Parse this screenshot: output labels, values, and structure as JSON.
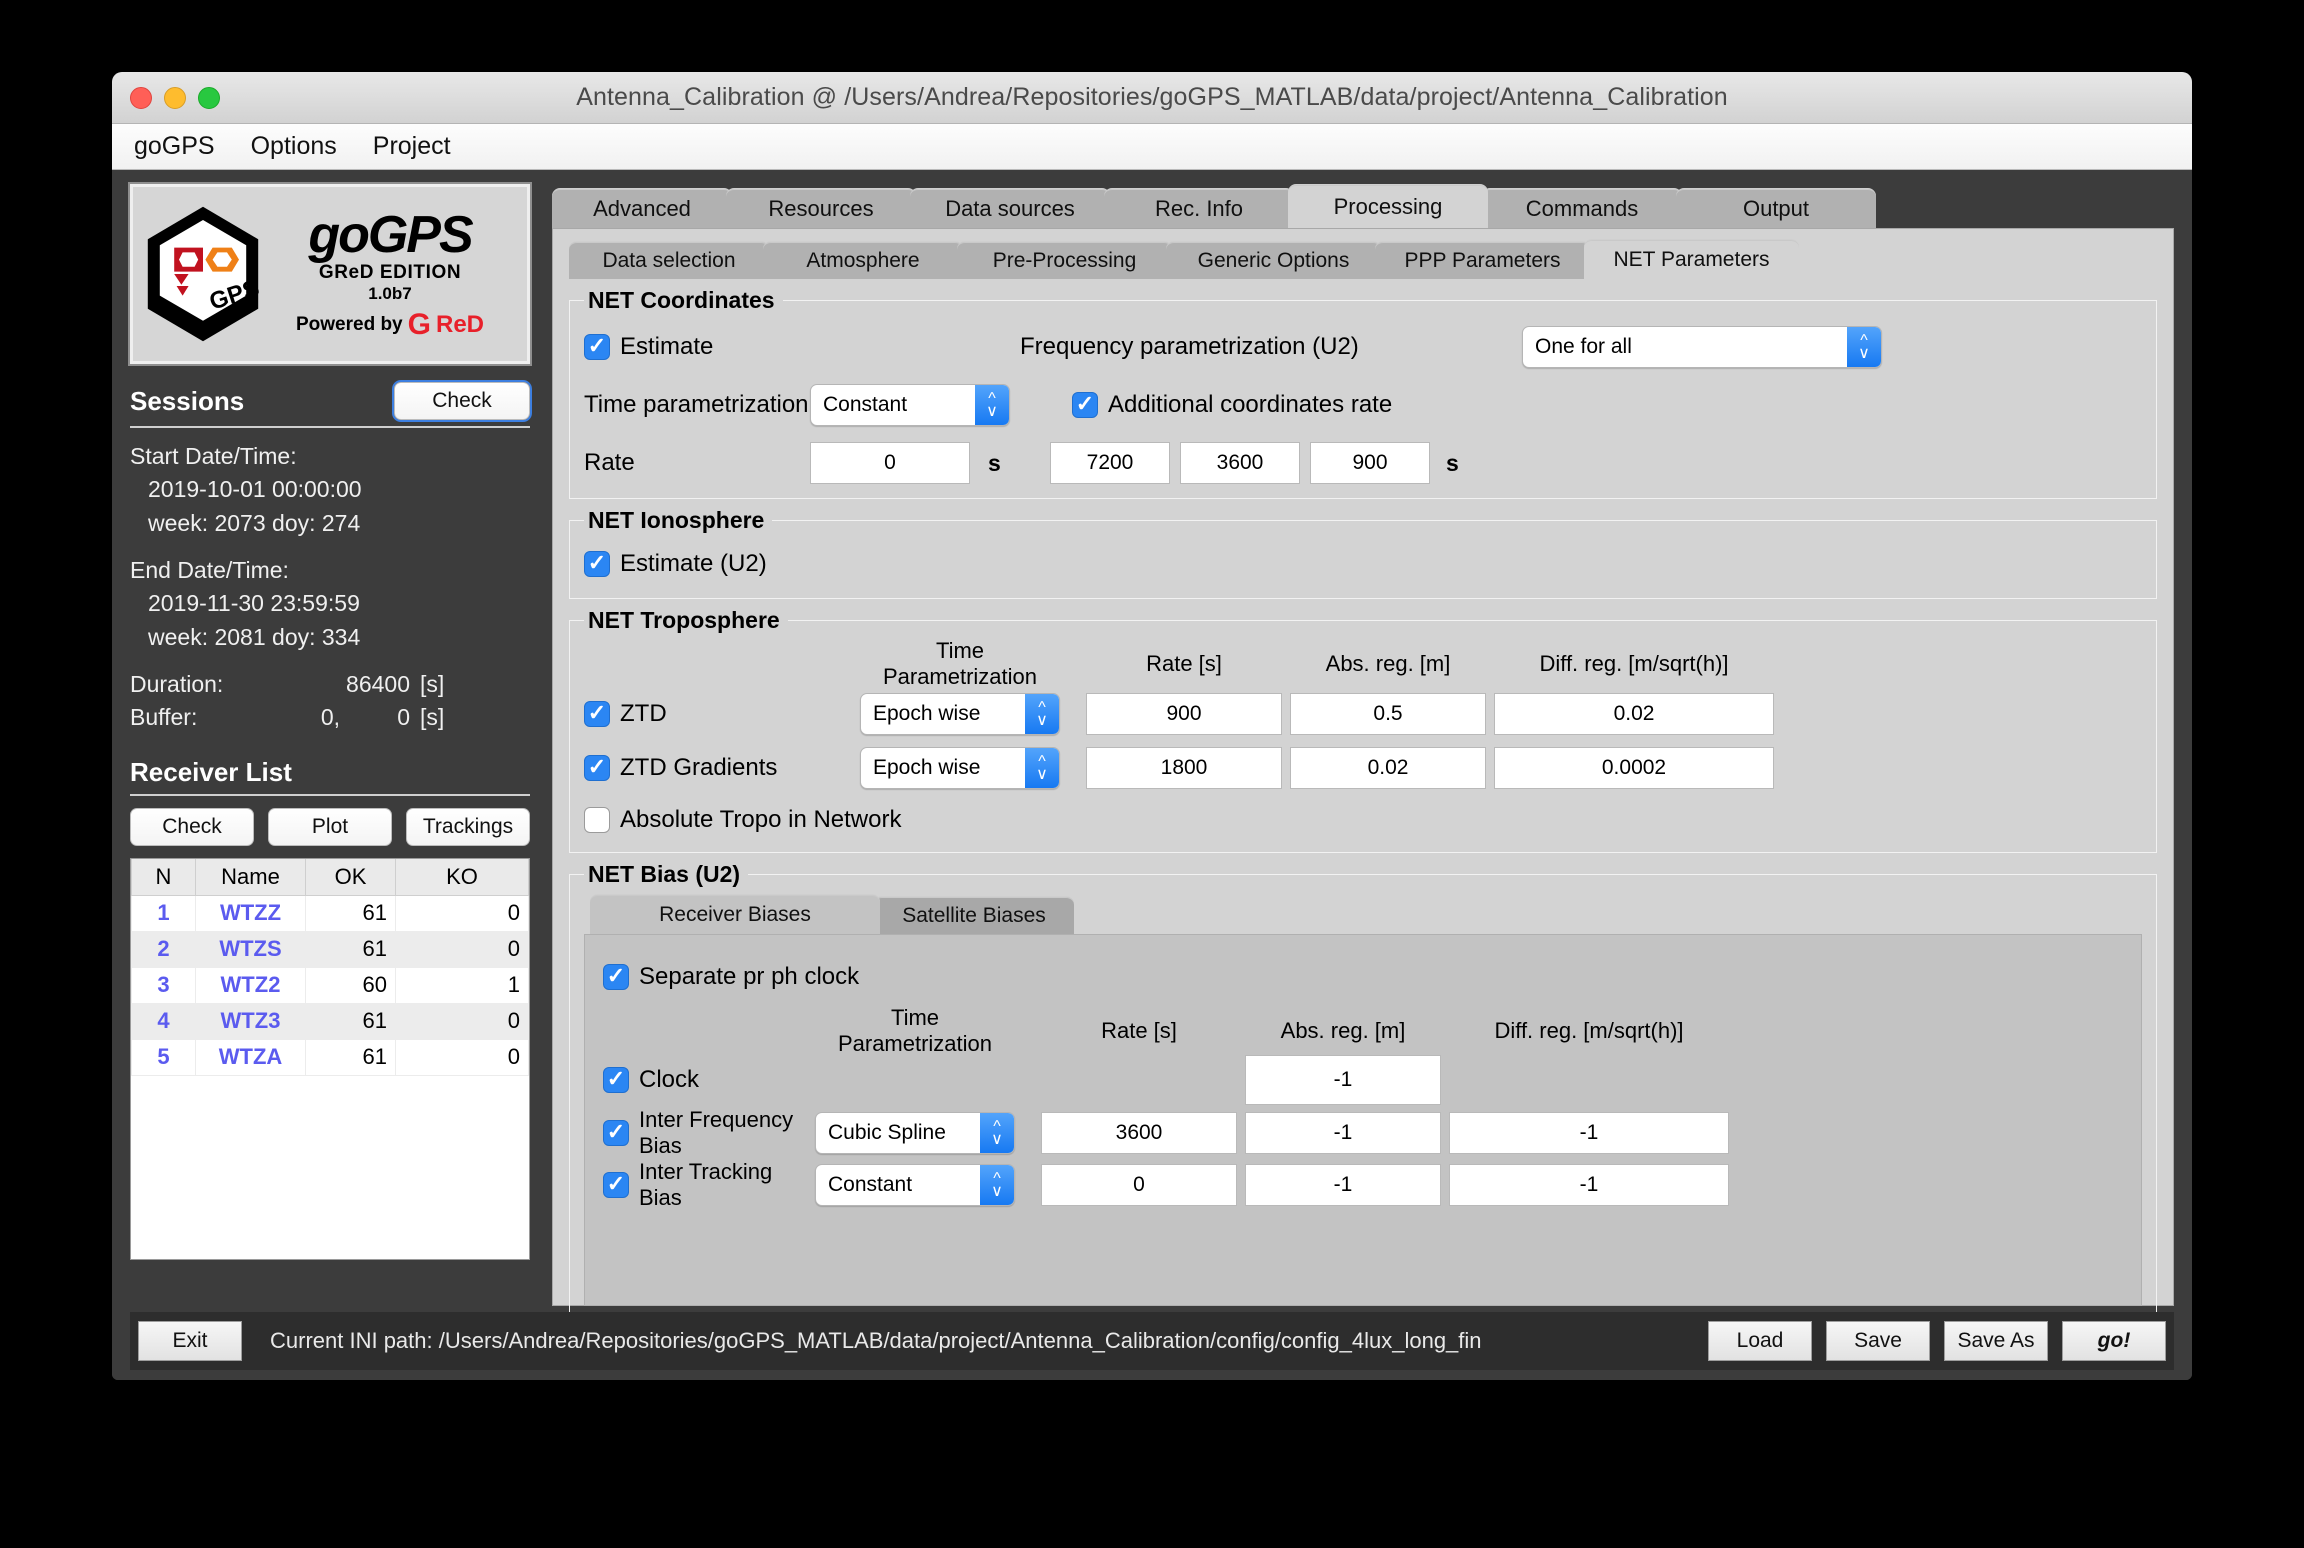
{
  "window": {
    "title": "Antenna_Calibration @ /Users/Andrea/Repositories/goGPS_MATLAB/data/project/Antenna_Calibration"
  },
  "menubar": {
    "items": [
      "goGPS",
      "Options",
      "Project"
    ]
  },
  "logo": {
    "title": "goGPS",
    "edition": "GReD EDITION",
    "version": "1.0b7",
    "powered_prefix": "Powered by",
    "powered_brand_g": "G",
    "powered_brand_rest": "ReD",
    "mark_label": "GPS"
  },
  "sessions": {
    "title": "Sessions",
    "check_label": "Check",
    "start_label": "Start Date/Time:",
    "start_value": "2019-10-01  00:00:00",
    "start_week": "week: 2073 doy: 274",
    "end_label": "End Date/Time:",
    "end_value": "2019-11-30  23:59:59",
    "end_week": "week: 2081 doy: 334",
    "duration_key": "Duration:",
    "duration_value": "86400",
    "duration_unit": "[s]",
    "buffer_key": "Buffer:",
    "buffer_value_1": "0,",
    "buffer_value_2": "0",
    "buffer_unit": "[s]"
  },
  "receiver_list": {
    "title": "Receiver List",
    "buttons": [
      "Check",
      "Plot",
      "Trackings"
    ],
    "columns": [
      "N",
      "Name",
      "OK",
      "KO"
    ],
    "rows": [
      {
        "n": "1",
        "name": "WTZZ",
        "ok": "61",
        "ko": "0"
      },
      {
        "n": "2",
        "name": "WTZS",
        "ok": "61",
        "ko": "0"
      },
      {
        "n": "3",
        "name": "WTZ2",
        "ok": "60",
        "ko": "1"
      },
      {
        "n": "4",
        "name": "WTZ3",
        "ok": "61",
        "ko": "0"
      },
      {
        "n": "5",
        "name": "WTZA",
        "ok": "61",
        "ko": "0"
      }
    ]
  },
  "tabs_primary": {
    "items": [
      "Advanced",
      "Resources",
      "Data sources",
      "Rec. Info",
      "Processing",
      "Commands",
      "Output"
    ],
    "active": "Processing"
  },
  "tabs_secondary": {
    "items": [
      "Data selection",
      "Atmosphere",
      "Pre-Processing",
      "Generic Options",
      "PPP Parameters",
      "NET Parameters"
    ],
    "active": "NET Parameters"
  },
  "net_coordinates": {
    "legend": "NET Coordinates",
    "estimate_label": "Estimate",
    "estimate_checked": true,
    "time_param_label": "Time parametrization",
    "time_param_value": "Constant",
    "rate_label": "Rate",
    "rate_value": "0",
    "rate_unit": "s",
    "freq_param_label": "Frequency parametrization (U2)",
    "freq_param_value": "One for all",
    "additional_rate_label": "Additional coordinates rate",
    "additional_rate_checked": true,
    "additional_rates": [
      "7200",
      "3600",
      "900"
    ],
    "additional_rates_unit": "s"
  },
  "net_ionosphere": {
    "legend": "NET Ionosphere",
    "estimate_label": "Estimate (U2)",
    "estimate_checked": true
  },
  "net_troposphere": {
    "legend": "NET Troposphere",
    "columns": [
      "Time Parametrization",
      "Rate [s]",
      "Abs. reg. [m]",
      "Diff. reg. [m/sqrt(h)]"
    ],
    "rows": [
      {
        "label": "ZTD",
        "checked": true,
        "time_param": "Epoch wise",
        "rate": "900",
        "abs_reg": "0.5",
        "diff_reg": "0.02"
      },
      {
        "label": "ZTD Gradients",
        "checked": true,
        "time_param": "Epoch wise",
        "rate": "1800",
        "abs_reg": "0.02",
        "diff_reg": "0.0002"
      }
    ],
    "absolute_tropo_label": "Absolute Tropo in Network",
    "absolute_tropo_checked": false
  },
  "net_bias": {
    "legend": "NET Bias (U2)",
    "tabs": [
      "Receiver Biases",
      "Satellite Biases"
    ],
    "active_tab": "Receiver Biases",
    "separate_label": "Separate pr ph clock",
    "separate_checked": true,
    "columns": [
      "Time Parametrization",
      "Rate [s]",
      "Abs. reg. [m]",
      "Diff. reg. [m/sqrt(h)]"
    ],
    "rows": [
      {
        "label": "Clock",
        "checked": true,
        "time_param": null,
        "rate": null,
        "abs_reg": "-1",
        "diff_reg": null
      },
      {
        "label": "Inter Frequency Bias",
        "checked": true,
        "time_param": "Cubic Spline",
        "rate": "3600",
        "abs_reg": "-1",
        "diff_reg": "-1"
      },
      {
        "label": "Inter Tracking Bias",
        "checked": true,
        "time_param": "Constant",
        "rate": "0",
        "abs_reg": "-1",
        "diff_reg": "-1"
      }
    ]
  },
  "bottom_bar": {
    "exit_label": "Exit",
    "ini_label": "Current INI path:",
    "ini_path": "/Users/Andrea/Repositories/goGPS_MATLAB/data/project/Antenna_Calibration/config/config_4lux_long_fin",
    "load_label": "Load",
    "save_label": "Save",
    "save_as_label": "Save As",
    "go_label": "go!"
  },
  "colors": {
    "accent_blue": "#2b86f3",
    "link_blue": "#5b5bef",
    "panel_gray": "#d3d3d3",
    "window_dark": "#3c3c3c"
  }
}
